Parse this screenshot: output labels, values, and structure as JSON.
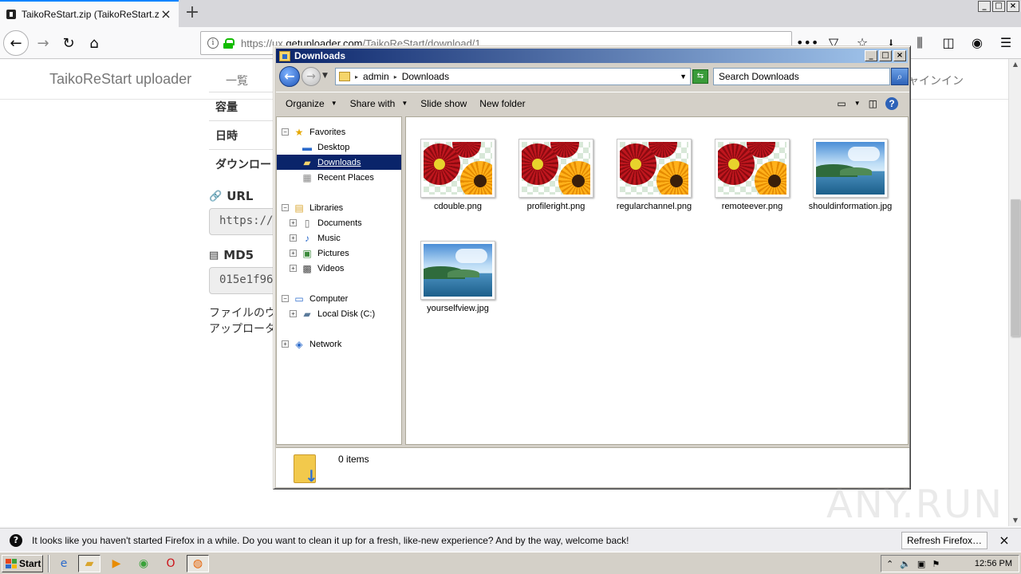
{
  "firefox": {
    "tab_title": "TaikoReStart.zip (TaikoReStart.zip",
    "new_tab": "+",
    "url_prefix": "https://ux.",
    "url_domain": "getuploader.com",
    "url_path": "/TaikoReStart/download/1",
    "url_extras": "•••"
  },
  "webpage": {
    "brand": "TaikoReStart uploader",
    "nav_list": "一覧",
    "nav_login": "ャインイン",
    "rows": [
      "容量",
      "日時",
      "ダウンロー"
    ],
    "url_heading": "URL",
    "url_value": "https://ux",
    "md5_heading": "MD5",
    "md5_value": "015e1f96",
    "note_line1": "ファイルのウ",
    "note_line2": "アップロータ"
  },
  "explorer": {
    "title": "Downloads",
    "path": [
      "admin",
      "Downloads"
    ],
    "search_placeholder": "Search Downloads",
    "toolbar": {
      "organize": "Organize",
      "share_with": "Share with",
      "slide_show": "Slide show",
      "new_folder": "New folder"
    },
    "nav": {
      "favorites": "Favorites",
      "desktop": "Desktop",
      "downloads": "Downloads",
      "recent_places": "Recent Places",
      "libraries": "Libraries",
      "documents": "Documents",
      "music": "Music",
      "pictures": "Pictures",
      "videos": "Videos",
      "computer": "Computer",
      "local_disk": "Local Disk (C:)",
      "network": "Network"
    },
    "files": [
      {
        "name": "cdouble.png",
        "kind": "flowers"
      },
      {
        "name": "profileright.png",
        "kind": "flowers"
      },
      {
        "name": "regularchannel.png",
        "kind": "flowers"
      },
      {
        "name": "remoteever.png",
        "kind": "flowers"
      },
      {
        "name": "shouldinformation.jpg",
        "kind": "sea"
      },
      {
        "name": "yourselfview.jpg",
        "kind": "sea"
      }
    ],
    "details": "0 items"
  },
  "notification": {
    "message": "It looks like you haven't started Firefox in a while. Do you want to clean it up for a fresh, like-new experience? And by the way, welcome back!",
    "refresh": "Refresh Firefox…"
  },
  "taskbar": {
    "start": "Start",
    "clock": "12:56 PM"
  },
  "watermark": "ANY.RUN",
  "colors": {
    "titlebar_start": "#0a246a",
    "titlebar_end": "#a6caf0",
    "selection": "#0a246a",
    "ff_accent": "#0a84ff"
  }
}
